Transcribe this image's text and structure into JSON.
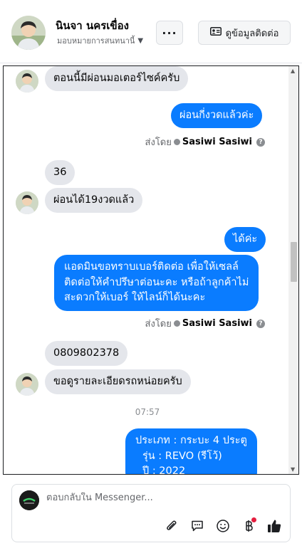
{
  "header": {
    "contact_name": "นินจา นครเขื่อง",
    "assignee_label": "มอบหมายการสนทนานี้",
    "more_label": "···",
    "contact_info_label": "ดูข้อมูลติดต่อ"
  },
  "messages": {
    "m1": "ตอนนี้มีผ่อนมอเตอร์ไซค์ครับ",
    "m2": "ผ่อนกี่งวดแล้วค่ะ",
    "sent_by_1": {
      "prefix": "ส่งโดย",
      "name": "Sasiwi Sasiwi"
    },
    "m3": "36",
    "m4": "ผ่อนได้19งวดแล้ว",
    "m5": "ได้ค่ะ",
    "m6": [
      "แอดมินขอทราบเบอร์ติดต่อ เพื่อให้เซลล์",
      "ติดต่อให้คำปรึษาต่อนะคะ หรือถ้าลูกค้าไม่",
      "สะดวกให้เบอร์ ให้ไลน์ก็ได้นะคะ"
    ],
    "sent_by_2": {
      "prefix": "ส่งโดย",
      "name": "Sasiwi Sasiwi"
    },
    "m7": "0809802378",
    "m8": "ขอดูรายละเอียดรถหน่อยครับ",
    "timestamp": "07:57",
    "m9": [
      "ประเภท : กระบะ 4 ประตู",
      "รุ่น : REVO (รีโว้)",
      "ปี : 2022"
    ]
  },
  "composer": {
    "placeholder": "ตอบกลับใน Messenger..."
  },
  "icons": {
    "toolbar": [
      "paperclip-icon",
      "speech-bubble-icon",
      "emoji-icon",
      "baht-icon",
      "thumbs-up-icon"
    ]
  },
  "colors": {
    "outgoing_bubble": "#0a7cff",
    "incoming_bubble": "#e4e6eb",
    "notification_dot": "#e41e3f"
  }
}
